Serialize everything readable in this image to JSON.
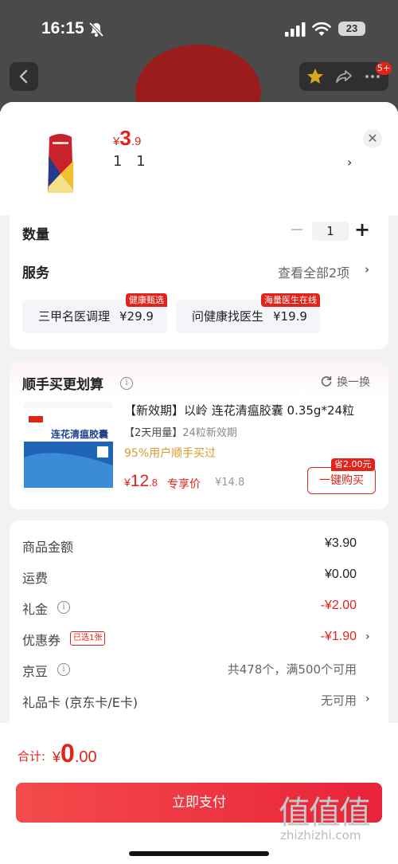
{
  "status_bar": {
    "time": "16:15",
    "battery": "23"
  },
  "top_nav": {
    "badge": "5+"
  },
  "product": {
    "price_symbol": "¥",
    "price_int": "3",
    "price_dec": ".9",
    "spec": "1 1"
  },
  "quantity": {
    "label": "数量",
    "value": "1",
    "minus": "−",
    "plus": "+"
  },
  "services": {
    "label": "服务",
    "more": "查看全部2项",
    "items": [
      {
        "name": "三甲名医调理",
        "price": "¥29.9",
        "tag": "健康甄选"
      },
      {
        "name": "问健康找医生",
        "price": "¥19.9",
        "tag": "海量医生在线"
      }
    ]
  },
  "recommend": {
    "title": "顺手买更划算",
    "refresh": "换一换",
    "name": "【新效期】以岭 连花清瘟胶囊 0.35g*24粒",
    "sub_highlight": "【2天用量】",
    "sub_rest": "24粒新效期",
    "popularity": "95%用户顺手买过",
    "price_symbol": "¥",
    "price_int": "12",
    "price_dec": ".8",
    "exclusive": "专享价",
    "original": "¥14.8",
    "save_tag": "省2.00元",
    "buy": "一键购买",
    "box_title": "连花清瘟胶囊"
  },
  "summary": {
    "rows": [
      {
        "label": "商品金额",
        "value": "¥3.90"
      },
      {
        "label": "运费",
        "value": "¥0.00"
      },
      {
        "label": "礼金",
        "value": "-¥2.00"
      },
      {
        "label": "优惠券",
        "value": "-¥1.90",
        "chosen": "已选1张"
      },
      {
        "label": "京豆",
        "value": "共478个，满500个可用"
      },
      {
        "label": "礼品卡 (京东卡/E卡)",
        "value": "无可用"
      }
    ]
  },
  "footer": {
    "total_label": "合计:",
    "total_symbol": "¥",
    "total_int": "0",
    "total_dec": ".00",
    "pay": "立即支付",
    "watermark_glyphs": "值值值",
    "watermark_site": "zhizhizhi.com"
  },
  "colors": {
    "accent": "#e2231a",
    "warning": "#d99a2b",
    "overlay": "#4a4a4a"
  },
  "icons": [
    "bell-slash-icon",
    "signal-icon",
    "wifi-icon",
    "back-icon",
    "star-icon",
    "share-icon",
    "more-icon",
    "close-icon",
    "info-icon",
    "refresh-icon",
    "chevron-right-icon"
  ]
}
